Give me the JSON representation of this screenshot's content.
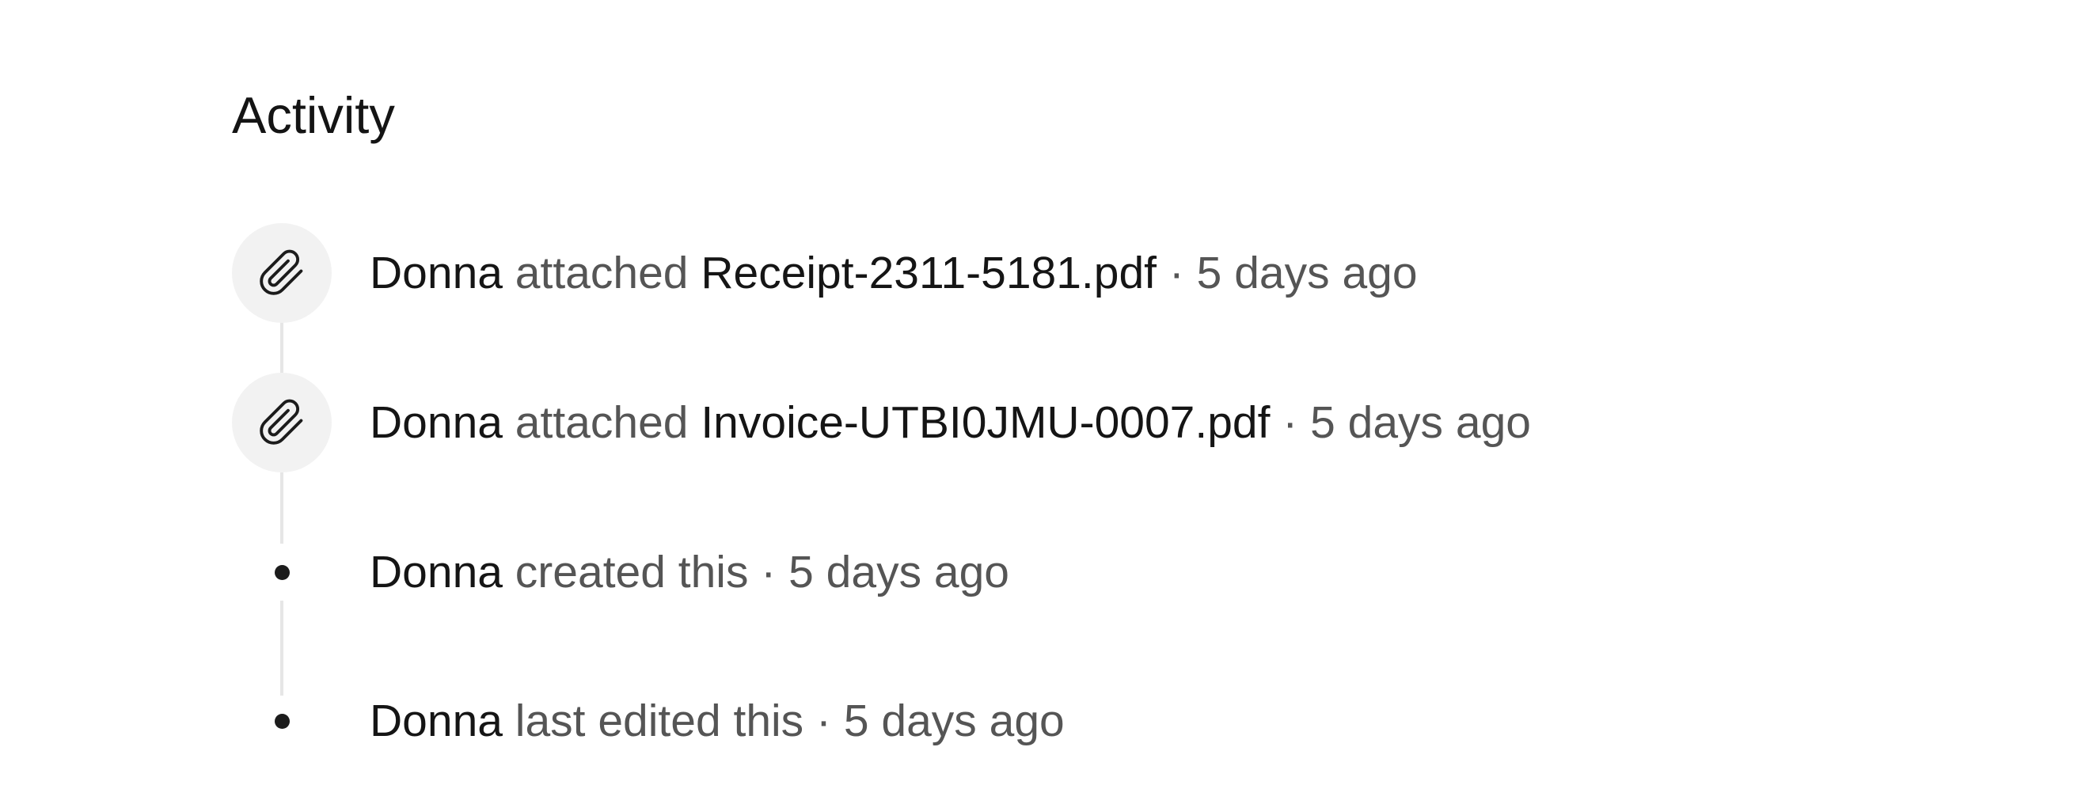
{
  "activity": {
    "title": "Activity",
    "items": [
      {
        "type": "attachment",
        "icon": "paperclip-icon",
        "actor": "Donna",
        "action": " attached ",
        "target": "Receipt-2311-5181.pdf",
        "separator": " · ",
        "time": "5 days ago"
      },
      {
        "type": "attachment",
        "icon": "paperclip-icon",
        "actor": "Donna",
        "action": " attached ",
        "target": "Invoice-UTBI0JMU-0007.pdf",
        "separator": " · ",
        "time": "5 days ago"
      },
      {
        "type": "event",
        "icon": "bullet-dot-icon",
        "actor": "Donna",
        "action": " created this",
        "separator": " · ",
        "time": "5 days ago"
      },
      {
        "type": "event",
        "icon": "bullet-dot-icon",
        "actor": "Donna",
        "action": " last edited this",
        "separator": " · ",
        "time": "5 days ago"
      }
    ]
  },
  "colors": {
    "primary_text": "#151515",
    "secondary_text": "#555555",
    "icon_bg": "#f2f2f2",
    "timeline": "#e6e6e6"
  }
}
